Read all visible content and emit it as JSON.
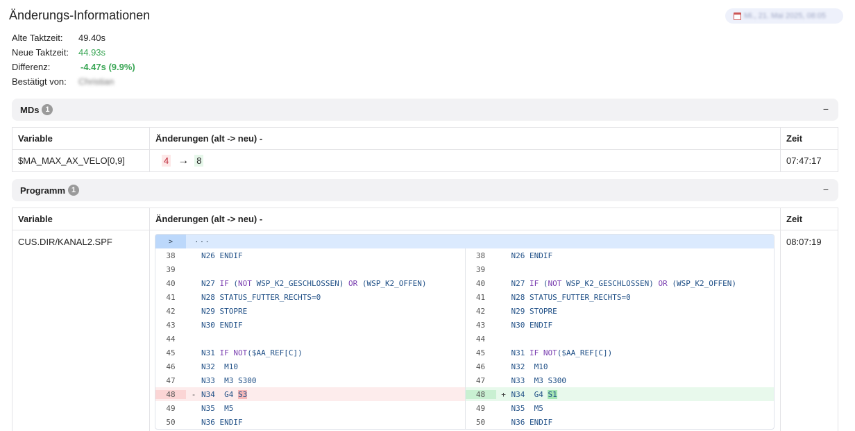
{
  "header": {
    "title": "Änderungs-Informationen",
    "date": "Mi., 21. Mai 2025, 08:05"
  },
  "info": {
    "alte_label": "Alte Taktzeit:",
    "alte_value": "49.40s",
    "neue_label": "Neue Taktzeit:",
    "neue_value": "44.93s",
    "diff_label": "Differenz:",
    "diff_value": "-4.47s (9.9%)",
    "bestaetigt_label": "Bestätigt von:",
    "bestaetigt_value": "Christian"
  },
  "mds": {
    "title": "MDs",
    "count": "1",
    "toggle": "−",
    "headers": [
      "Variable",
      "Änderungen (alt -> neu) -",
      "Zeit"
    ],
    "row": {
      "variable": "$MA_MAX_AX_VELO[0,9]",
      "old": "4",
      "arrow": "→",
      "new": "8",
      "time": "07:47:17"
    }
  },
  "programm": {
    "title": "Programm",
    "count": "1",
    "toggle": "−",
    "headers": [
      "Variable",
      "Änderungen (alt -> neu) -",
      "Zeit"
    ],
    "row": {
      "variable": "CUS.DIR/KANAL2.SPF",
      "time": "08:07:19"
    },
    "fold": {
      "button": ">",
      "dots": "···"
    },
    "left": [
      {
        "num": "38",
        "mark": "",
        "pre": "N26 ENDIF",
        "hl": "",
        "post": "",
        "state": ""
      },
      {
        "num": "39",
        "mark": "",
        "pre": "",
        "hl": "",
        "post": "",
        "state": ""
      },
      {
        "num": "40",
        "mark": "",
        "pre": "N27 IF (NOT WSP_K2_GESCHLOSSEN) OR (WSP_K2_OFFEN)",
        "hl": "",
        "post": "",
        "state": ""
      },
      {
        "num": "41",
        "mark": "",
        "pre": "N28 STATUS_FUTTER_RECHTS=0",
        "hl": "",
        "post": "",
        "state": ""
      },
      {
        "num": "42",
        "mark": "",
        "pre": "N29 STOPRE",
        "hl": "",
        "post": "",
        "state": ""
      },
      {
        "num": "43",
        "mark": "",
        "pre": "N30 ENDIF",
        "hl": "",
        "post": "",
        "state": ""
      },
      {
        "num": "44",
        "mark": "",
        "pre": "",
        "hl": "",
        "post": "",
        "state": ""
      },
      {
        "num": "45",
        "mark": "",
        "pre": "N31 IF NOT($AA_REF[C])",
        "hl": "",
        "post": "",
        "state": ""
      },
      {
        "num": "46",
        "mark": "",
        "pre": "N32  M10",
        "hl": "",
        "post": "",
        "state": ""
      },
      {
        "num": "47",
        "mark": "",
        "pre": "N33  M3 S300",
        "hl": "",
        "post": "",
        "state": ""
      },
      {
        "num": "48",
        "mark": "-",
        "pre": "N34  G4 ",
        "hl": "S3",
        "post": "",
        "state": "del"
      },
      {
        "num": "49",
        "mark": "",
        "pre": "N35  M5",
        "hl": "",
        "post": "",
        "state": ""
      },
      {
        "num": "50",
        "mark": "",
        "pre": "N36 ENDIF",
        "hl": "",
        "post": "",
        "state": ""
      }
    ],
    "right": [
      {
        "num": "38",
        "mark": "",
        "pre": "N26 ENDIF",
        "hl": "",
        "post": "",
        "state": ""
      },
      {
        "num": "39",
        "mark": "",
        "pre": "",
        "hl": "",
        "post": "",
        "state": ""
      },
      {
        "num": "40",
        "mark": "",
        "pre": "N27 IF (NOT WSP_K2_GESCHLOSSEN) OR (WSP_K2_OFFEN)",
        "hl": "",
        "post": "",
        "state": ""
      },
      {
        "num": "41",
        "mark": "",
        "pre": "N28 STATUS_FUTTER_RECHTS=0",
        "hl": "",
        "post": "",
        "state": ""
      },
      {
        "num": "42",
        "mark": "",
        "pre": "N29 STOPRE",
        "hl": "",
        "post": "",
        "state": ""
      },
      {
        "num": "43",
        "mark": "",
        "pre": "N30 ENDIF",
        "hl": "",
        "post": "",
        "state": ""
      },
      {
        "num": "44",
        "mark": "",
        "pre": "",
        "hl": "",
        "post": "",
        "state": ""
      },
      {
        "num": "45",
        "mark": "",
        "pre": "N31 IF NOT($AA_REF[C])",
        "hl": "",
        "post": "",
        "state": ""
      },
      {
        "num": "46",
        "mark": "",
        "pre": "N32  M10",
        "hl": "",
        "post": "",
        "state": ""
      },
      {
        "num": "47",
        "mark": "",
        "pre": "N33  M3 S300",
        "hl": "",
        "post": "",
        "state": ""
      },
      {
        "num": "48",
        "mark": "+",
        "pre": "N34  G4 ",
        "hl": "S1",
        "post": "",
        "state": "add"
      },
      {
        "num": "49",
        "mark": "",
        "pre": "N35  M5",
        "hl": "",
        "post": "",
        "state": ""
      },
      {
        "num": "50",
        "mark": "",
        "pre": "N36 ENDIF",
        "hl": "",
        "post": "",
        "state": ""
      }
    ]
  }
}
